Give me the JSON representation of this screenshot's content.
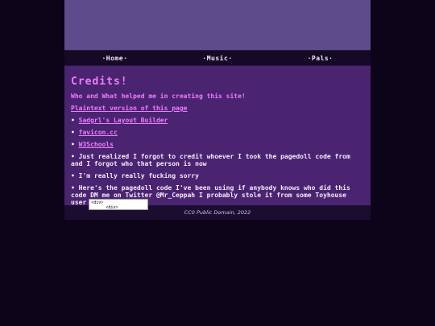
{
  "nav": {
    "home": "·Home·",
    "music": "·Music·",
    "pals": "·Pals·"
  },
  "content": {
    "title": "Credits!",
    "subtitle": "Who and What helped me in creating this site!",
    "plaintext_link": "Plaintext version of this page",
    "items": [
      {
        "bullet": "• ",
        "link": "Sadgrl's Layout Builder"
      },
      {
        "bullet": "• ",
        "link": "favicon.cc"
      },
      {
        "bullet": "• ",
        "link": "W3Schools"
      }
    ],
    "note1": "• Just realized I forgot to credit whoever I took the pagedoll code from and I forgot who that person is now",
    "note2": "• I'm really really fucking sorry",
    "note3": "• Here's the pagedoll code I've been using if anybody knows who did this code DM me on Twitter @Mr_Ceppah I probably stole it from some Toyhouse user",
    "code_text": "<div>\n      <div>"
  },
  "footer": {
    "text": "CC0 Public Domain, 2022"
  },
  "colors": {
    "background": "#0c0418",
    "banner": "#5e4b8b",
    "content": "#4a2470",
    "accent": "#ee7cff"
  }
}
